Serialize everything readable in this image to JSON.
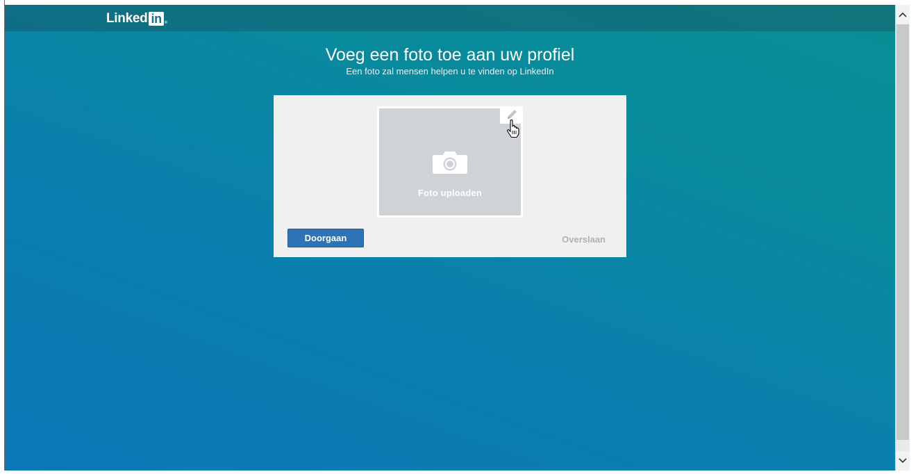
{
  "header": {
    "logo_text": "Linked",
    "logo_box_text": "in",
    "logo_mark": "®"
  },
  "main": {
    "title": "Voeg een foto toe aan uw profiel",
    "subtitle": "Een foto zal mensen helpen u te vinden op LinkedIn"
  },
  "photo_card": {
    "upload_label": "Foto uploaden",
    "camera_icon": "camera-icon",
    "edit_icon": "pencil-icon",
    "continue_label": "Doorgaan",
    "skip_label": "Overslaan"
  },
  "colors": {
    "accent": "#2d73b5",
    "background_start": "#0b78b7",
    "background_end": "#0a8f95",
    "card": "#f0f0f0",
    "placeholder": "#cfd3d7",
    "skip_text": "#b1b1b1"
  }
}
